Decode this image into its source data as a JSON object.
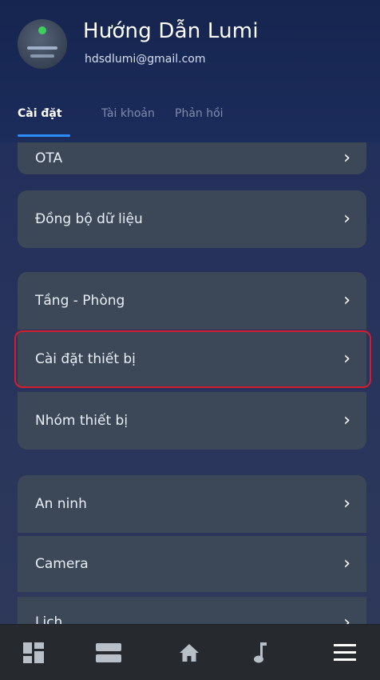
{
  "profile": {
    "name": "Hướng Dẫn Lumi",
    "email": "hdsdlumi@gmail.com"
  },
  "tabs": [
    {
      "label": "Cài đặt",
      "active": true
    },
    {
      "label": "Tài khoản",
      "active": false
    },
    {
      "label": "Phản hồi",
      "active": false
    }
  ],
  "menu": {
    "items": [
      {
        "label": "OTA",
        "icon": "chevron-right-icon"
      },
      {
        "label": "Đồng bộ dữ liệu",
        "icon": "chevron-right-icon"
      },
      {
        "label": "Tầng - Phòng",
        "icon": "chevron-right-icon"
      },
      {
        "label": "Cài đặt thiết bị",
        "icon": "chevron-right-icon",
        "highlighted": true
      },
      {
        "label": "Nhóm thiết bị",
        "icon": "chevron-right-icon"
      },
      {
        "label": "An ninh",
        "icon": "chevron-right-icon"
      },
      {
        "label": "Camera",
        "icon": "chevron-right-icon"
      },
      {
        "label": "Lịch",
        "icon": "chevron-right-icon"
      }
    ]
  },
  "bottom_nav": [
    {
      "icon": "dashboard-grid-icon"
    },
    {
      "icon": "rooms-list-icon"
    },
    {
      "icon": "home-icon"
    },
    {
      "icon": "music-note-icon"
    },
    {
      "icon": "menu-hamburger-icon"
    }
  ],
  "colors": {
    "accent": "#2d8cff",
    "highlight": "#d51d2f",
    "card": "#3c4858",
    "nav_bar": "#262a2f"
  }
}
